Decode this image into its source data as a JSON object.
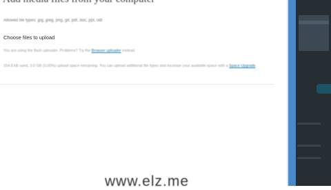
{
  "media_upload": {
    "heading": "Add media files from your computer",
    "allowed_types": "Allowed file types: jpg, jpeg, png, gif, pdf, doc, ppt, odt",
    "choose_files": "Choose files to upload",
    "uploader_notice_prefix": "You are using the flash uploader. Problems? Try the",
    "uploader_notice_link": "Browser uploader",
    "uploader_notice_suffix": "instead.",
    "quota_prefix": "154.8 kB used, 3.0 GB (0.00%) upload space remaining. You can upload additional file types and increase your available space with a",
    "quota_link": "Space Upgrade",
    "quota_suffix": "."
  },
  "watermark": {
    "text": "www.elz.me"
  },
  "colors": {
    "link": "#21759b",
    "sidebar_accent": "#4a88c8",
    "panel_background": "#262d33"
  }
}
